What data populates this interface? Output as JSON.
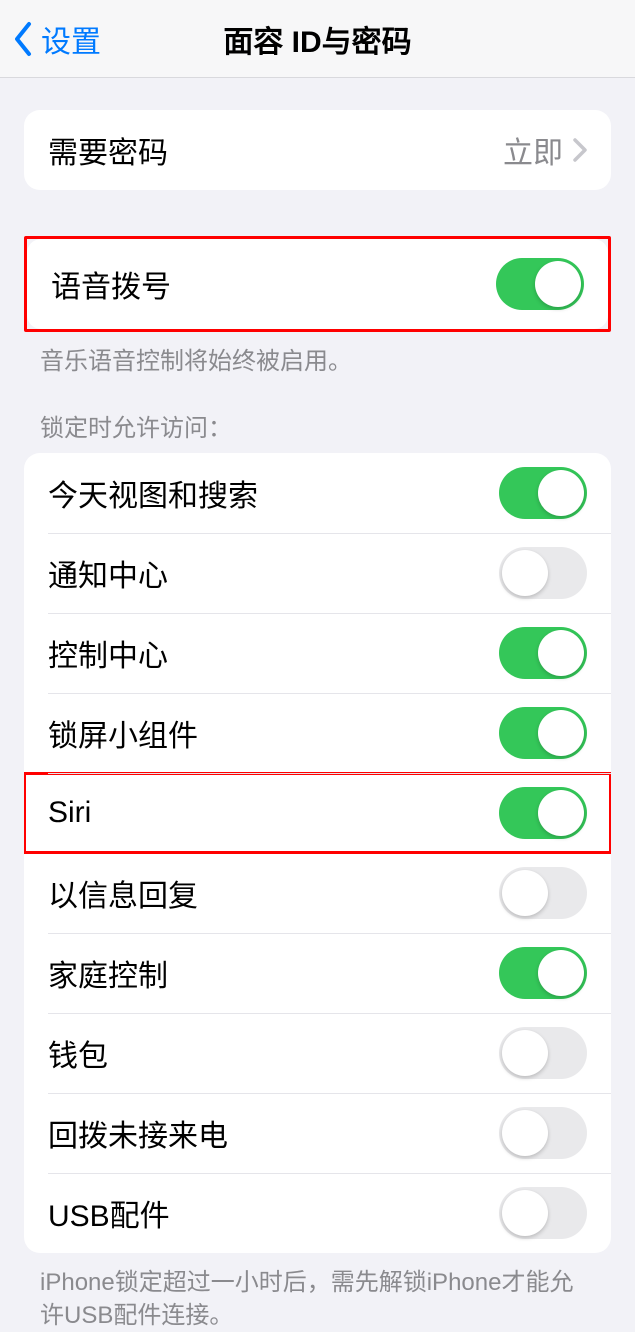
{
  "nav": {
    "back_label": "设置",
    "title": "面容 ID与密码"
  },
  "require_passcode": {
    "label": "需要密码",
    "value": "立即"
  },
  "voice_dial": {
    "label": "语音拨号",
    "on": true,
    "footer": "音乐语音控制将始终被启用。"
  },
  "locked_access": {
    "header": "锁定时允许访问：",
    "items": [
      {
        "label": "今天视图和搜索",
        "on": true
      },
      {
        "label": "通知中心",
        "on": false
      },
      {
        "label": "控制中心",
        "on": true
      },
      {
        "label": "锁屏小组件",
        "on": true
      },
      {
        "label": "Siri",
        "on": true
      },
      {
        "label": "以信息回复",
        "on": false
      },
      {
        "label": "家庭控制",
        "on": true
      },
      {
        "label": "钱包",
        "on": false
      },
      {
        "label": "回拨未接来电",
        "on": false
      },
      {
        "label": "USB配件",
        "on": false
      }
    ],
    "footer": "iPhone锁定超过一小时后，需先解锁iPhone才能允许USB配件连接。"
  }
}
